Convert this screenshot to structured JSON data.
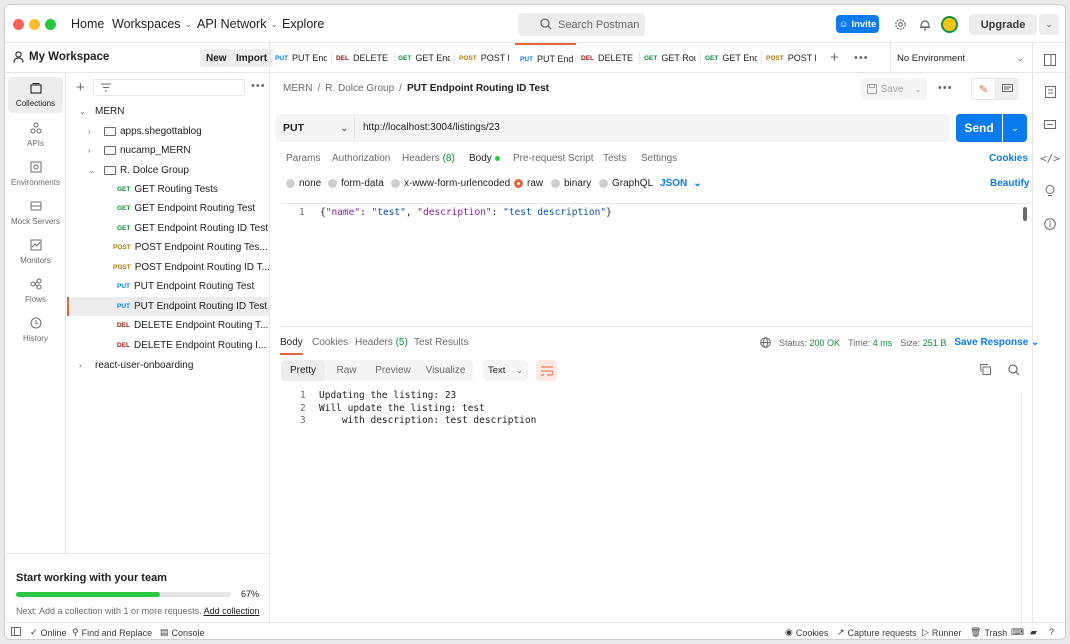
{
  "topnav": {
    "home": "Home",
    "workspaces": "Workspaces",
    "api_network": "API Network",
    "explore": "Explore",
    "search_placeholder": "Search Postman",
    "invite": "Invite",
    "upgrade": "Upgrade"
  },
  "workspace": {
    "name": "My Workspace",
    "new_btn": "New",
    "import_btn": "Import"
  },
  "rail": [
    {
      "label": "Collections",
      "icon": "collections-icon"
    },
    {
      "label": "APIs",
      "icon": "apis-icon"
    },
    {
      "label": "Environments",
      "icon": "environments-icon"
    },
    {
      "label": "Mock Servers",
      "icon": "mock-servers-icon"
    },
    {
      "label": "Monitors",
      "icon": "monitors-icon"
    },
    {
      "label": "Flows",
      "icon": "flows-icon"
    },
    {
      "label": "History",
      "icon": "history-icon"
    }
  ],
  "tree": {
    "root": "MERN",
    "folders": [
      "apps.shegottablog",
      "nucamp_MERN",
      "R. Dolce Group"
    ],
    "requests": [
      {
        "method": "GET",
        "name": "GET Routing Tests"
      },
      {
        "method": "GET",
        "name": "GET Endpoint Routing Test"
      },
      {
        "method": "GET",
        "name": "GET Endpoint Routing ID Test"
      },
      {
        "method": "POST",
        "name": "POST Endpoint Routing Tes..."
      },
      {
        "method": "POST",
        "name": "POST Endpoint Routing ID T..."
      },
      {
        "method": "PUT",
        "name": "PUT Endpoint Routing Test"
      },
      {
        "method": "PUT",
        "name": "PUT Endpoint Routing ID Test"
      },
      {
        "method": "DEL",
        "name": "DELETE Endpoint Routing T..."
      },
      {
        "method": "DEL",
        "name": "DELETE Endpoint Routing I..."
      }
    ],
    "other_collection": "react-user-onboarding"
  },
  "promo": {
    "title": "Start working with your team",
    "progress_pct": 67,
    "progress_label": "67%",
    "next_text": "Next: Add a collection with 1 or more requests.",
    "link": "Add collection"
  },
  "tabs": [
    {
      "method": "PUT",
      "label": "PUT End"
    },
    {
      "method": "DEL",
      "label": "DELETE E"
    },
    {
      "method": "GET",
      "label": "GET End"
    },
    {
      "method": "POST",
      "label": "POST E"
    },
    {
      "method": "PUT",
      "label": "PUT End"
    },
    {
      "method": "DEL",
      "label": "DELETE E"
    },
    {
      "method": "GET",
      "label": "GET Rou"
    },
    {
      "method": "GET",
      "label": "GET End"
    },
    {
      "method": "POST",
      "label": "POST E"
    }
  ],
  "environment": "No Environment",
  "request": {
    "breadcrumb": [
      "MERN",
      "R. Dolce Group",
      "PUT Endpoint Routing ID Test"
    ],
    "save": "Save",
    "method": "PUT",
    "url": "http://localhost:3004/listings/23",
    "send": "Send",
    "tabs": {
      "params": "Params",
      "authorization": "Authorization",
      "headers": "Headers",
      "headers_count": "(8)",
      "body": "Body",
      "prerequest": "Pre-request Script",
      "tests": "Tests",
      "settings": "Settings"
    },
    "cookies": "Cookies",
    "body_types": [
      "none",
      "form-data",
      "x-www-form-urlencoded",
      "raw",
      "binary",
      "GraphQL"
    ],
    "format": "JSON",
    "beautify": "Beautify",
    "body_line_no": "1",
    "body_code": {
      "open": "{",
      "k1": "\"name\"",
      "sep1": ": ",
      "v1": "\"test\"",
      "comma": ", ",
      "k2": "\"description\"",
      "sep2": ": ",
      "v2": "\"test description\"",
      "close": "}"
    }
  },
  "response": {
    "tabs": {
      "body": "Body",
      "cookies": "Cookies",
      "headers": "Headers",
      "headers_count": "(5)",
      "test_results": "Test Results"
    },
    "status_label": "Status:",
    "status": "200 OK",
    "time_label": "Time:",
    "time": "4 ms",
    "size_label": "Size:",
    "size": "251 B",
    "save_response": "Save Response",
    "views": [
      "Pretty",
      "Raw",
      "Preview",
      "Visualize"
    ],
    "text_format": "Text",
    "lines": [
      {
        "no": "1",
        "text": "Updating the listing: 23"
      },
      {
        "no": "2",
        "text": "Will update the listing: test"
      },
      {
        "no": "3",
        "text": "    with description: test description"
      }
    ]
  },
  "statusbar": {
    "online": "Online",
    "find_replace": "Find and Replace",
    "console": "Console",
    "cookies": "Cookies",
    "capture": "Capture requests",
    "runner": "Runner",
    "trash": "Trash"
  },
  "colors": {
    "accent": "#e2653d",
    "primary": "#097bed",
    "get": "#0e8a3c",
    "post": "#ad7a03",
    "put": "#097bed",
    "delete": "#8e1a10"
  }
}
